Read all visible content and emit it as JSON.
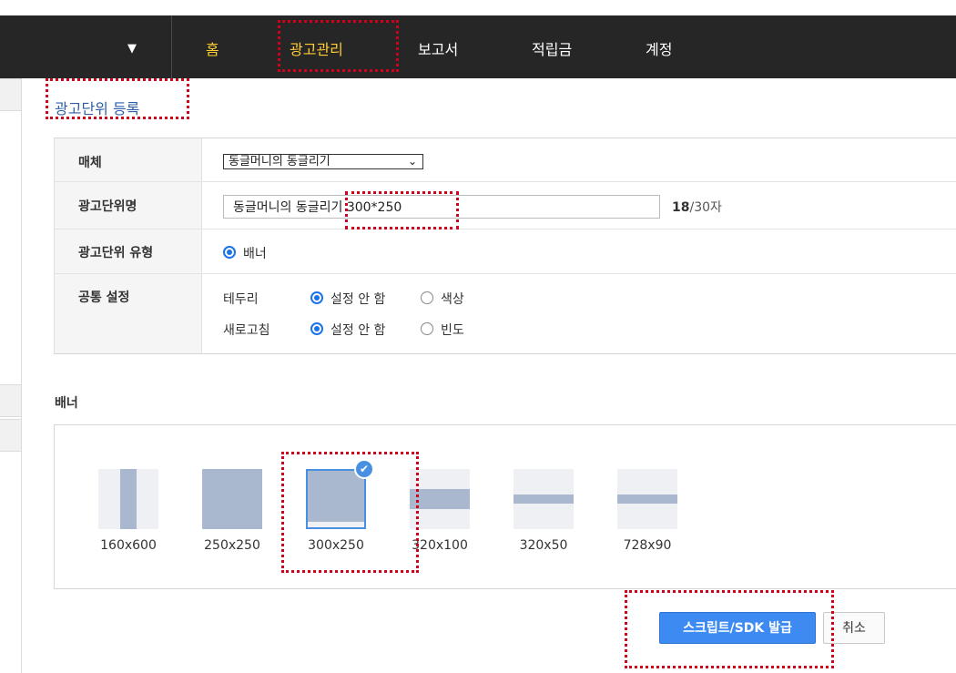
{
  "nav": {
    "items": [
      {
        "label": "홈",
        "active": true
      },
      {
        "label": "광고관리",
        "active": true
      },
      {
        "label": "보고서",
        "active": false
      },
      {
        "label": "적립금",
        "active": false
      },
      {
        "label": "계정",
        "active": false
      }
    ]
  },
  "page": {
    "title": "광고단위 등록"
  },
  "form": {
    "media": {
      "label": "매체",
      "value": "동글머니의 동글리기"
    },
    "unit_name": {
      "label": "광고단위명",
      "value": "동글머니의 동글리기 300*250",
      "count": "18",
      "max": "/30자"
    },
    "unit_type": {
      "label": "광고단위 유형",
      "option": "배너"
    },
    "common": {
      "label": "공통 설정",
      "border": {
        "label": "테두리",
        "opt1": "설정 안 함",
        "opt2": "색상"
      },
      "refresh": {
        "label": "새로고침",
        "opt1": "설정 안 함",
        "opt2": "빈도"
      }
    }
  },
  "banner": {
    "section_label": "배너",
    "sizes": [
      "160x600",
      "250x250",
      "300x250",
      "320x100",
      "320x50",
      "728x90"
    ],
    "selected": "300x250"
  },
  "actions": {
    "issue": "스크립트/SDK 발급",
    "cancel": "취소"
  },
  "colors": {
    "nav_bg": "#262626",
    "nav_active": "#ffcc33",
    "accent": "#3d8bf2",
    "annotation": "#d0021b"
  }
}
